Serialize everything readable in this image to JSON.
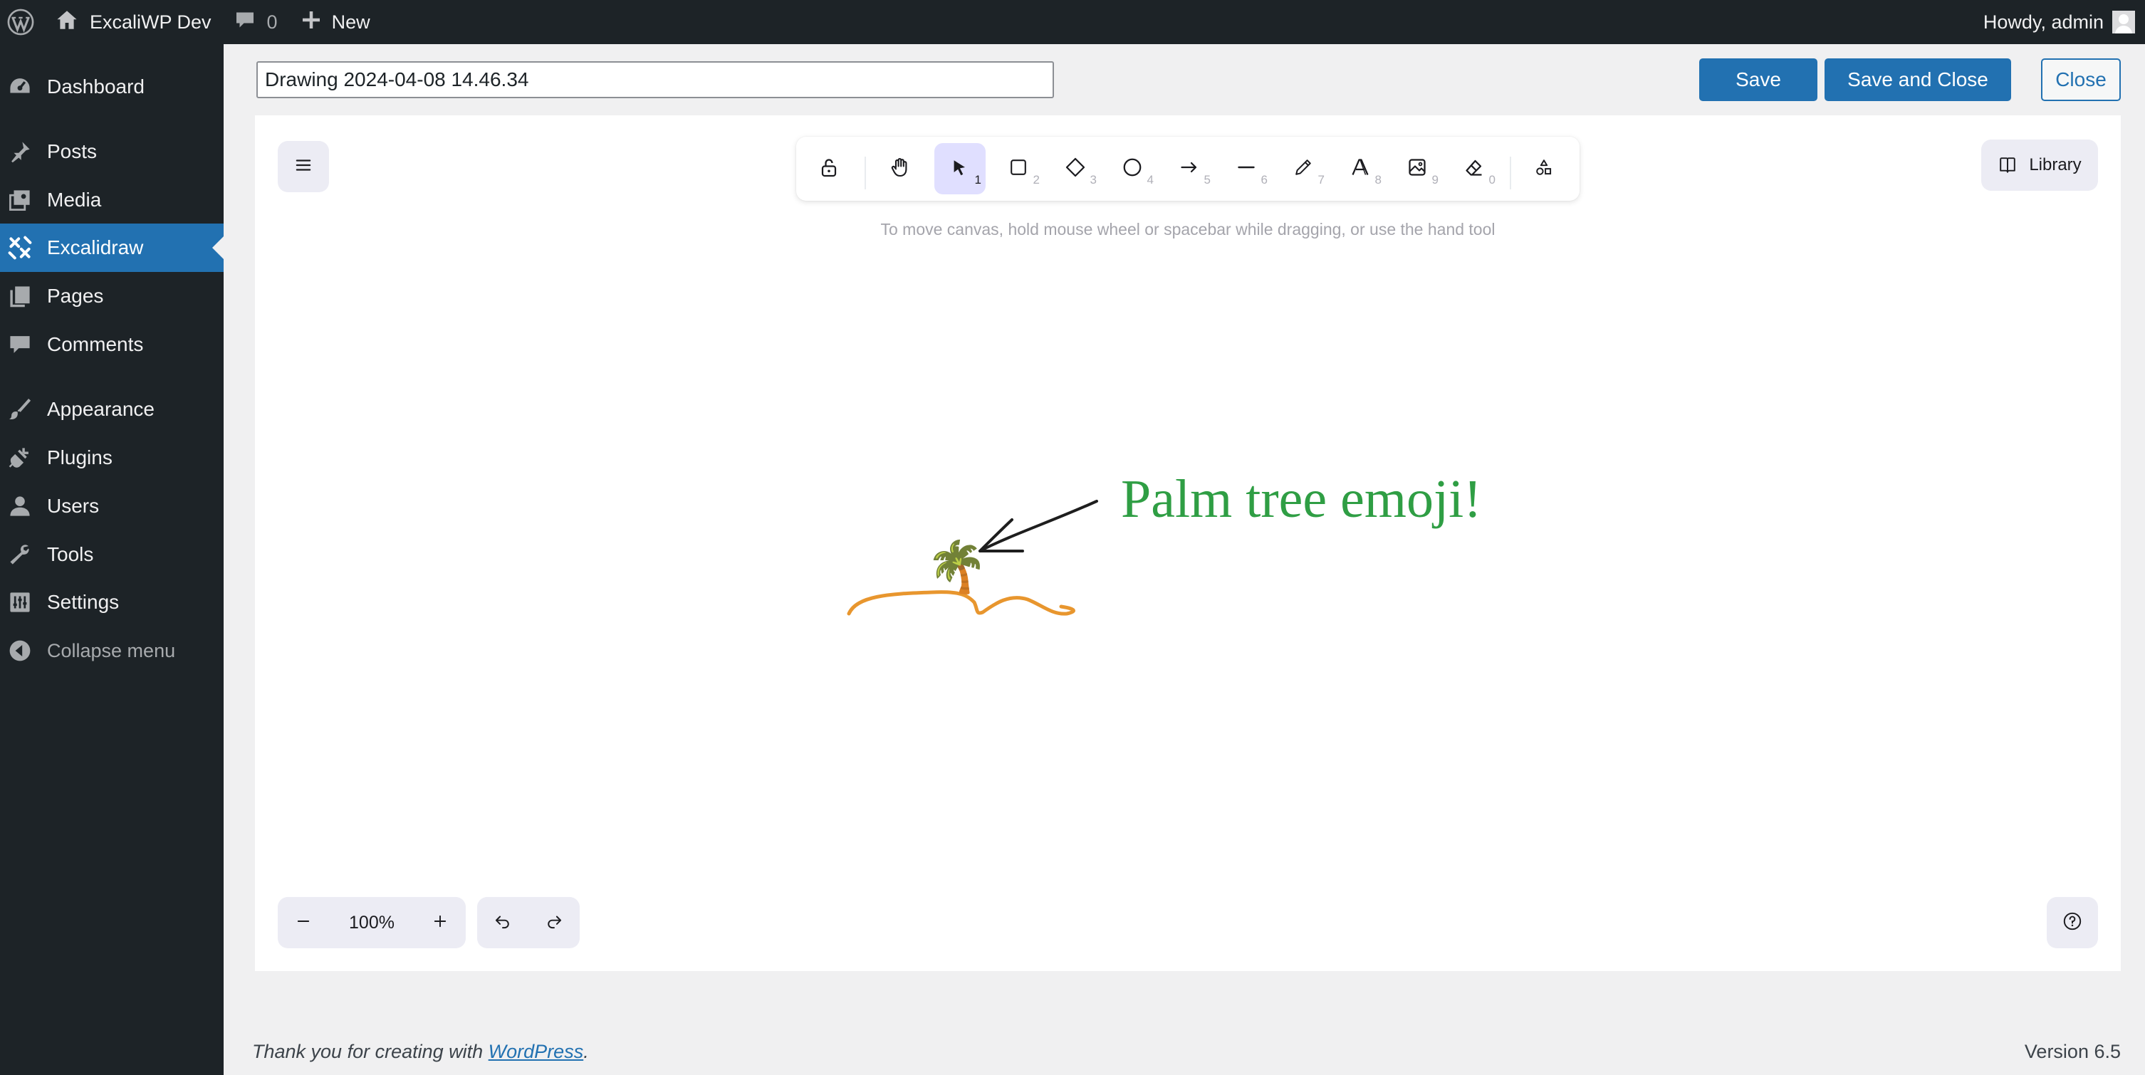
{
  "adminbar": {
    "site_name": "ExcaliWP Dev",
    "comments_count": "0",
    "new_label": "New",
    "howdy": "Howdy, admin",
    "bg_color": "#1d2327"
  },
  "sidebar": {
    "items": [
      {
        "label": "Dashboard",
        "icon": "dashboard-icon"
      },
      {
        "label": "Posts",
        "icon": "pushpin-icon"
      },
      {
        "label": "Media",
        "icon": "media-icon"
      },
      {
        "label": "Excalidraw",
        "icon": "excalidraw-icon",
        "current": true
      },
      {
        "label": "Pages",
        "icon": "pages-icon"
      },
      {
        "label": "Comments",
        "icon": "comments-icon"
      },
      {
        "label": "Appearance",
        "icon": "brush-icon"
      },
      {
        "label": "Plugins",
        "icon": "plugin-icon"
      },
      {
        "label": "Users",
        "icon": "users-icon"
      },
      {
        "label": "Tools",
        "icon": "wrench-icon"
      },
      {
        "label": "Settings",
        "icon": "settings-icon"
      }
    ],
    "collapse_label": "Collapse menu",
    "accent_color": "#2271b1"
  },
  "editor": {
    "title_value": "Drawing 2024-04-08 14.46.34",
    "save_label": "Save",
    "save_close_label": "Save and Close",
    "close_label": "Close"
  },
  "excalidraw": {
    "toolbar": {
      "tools": [
        {
          "name": "lock",
          "icon": "lock-open-icon",
          "key": ""
        },
        {
          "name": "hand",
          "icon": "hand-icon",
          "key": ""
        },
        {
          "name": "selection",
          "icon": "pointer-icon",
          "key": "1",
          "active": true
        },
        {
          "name": "rectangle",
          "icon": "rectangle-icon",
          "key": "2"
        },
        {
          "name": "diamond",
          "icon": "diamond-icon",
          "key": "3"
        },
        {
          "name": "ellipse",
          "icon": "ellipse-icon",
          "key": "4"
        },
        {
          "name": "arrow",
          "icon": "arrow-icon",
          "key": "5"
        },
        {
          "name": "line",
          "icon": "line-icon",
          "key": "6"
        },
        {
          "name": "draw",
          "icon": "pencil-icon",
          "key": "7"
        },
        {
          "name": "text",
          "icon": "text-icon",
          "key": "8"
        },
        {
          "name": "image",
          "icon": "image-icon",
          "key": "9"
        },
        {
          "name": "eraser",
          "icon": "eraser-icon",
          "key": "0"
        },
        {
          "name": "extra-tools",
          "icon": "shapes-icon",
          "key": ""
        }
      ],
      "active_color": "#e0dfff"
    },
    "library_label": "Library",
    "hint": "To move canvas, hold mouse wheel or spacebar while dragging, or use the hand tool",
    "zoom": "100%",
    "canvas_text": "Palm tree emoji!",
    "canvas_emoji": "🌴",
    "text_color": "#2f9e44",
    "sand_color": "#e8962e"
  },
  "footer": {
    "thanks_prefix": "Thank you for creating with ",
    "wordpress_link": "WordPress",
    "thanks_suffix": ".",
    "version": "Version 6.5"
  }
}
